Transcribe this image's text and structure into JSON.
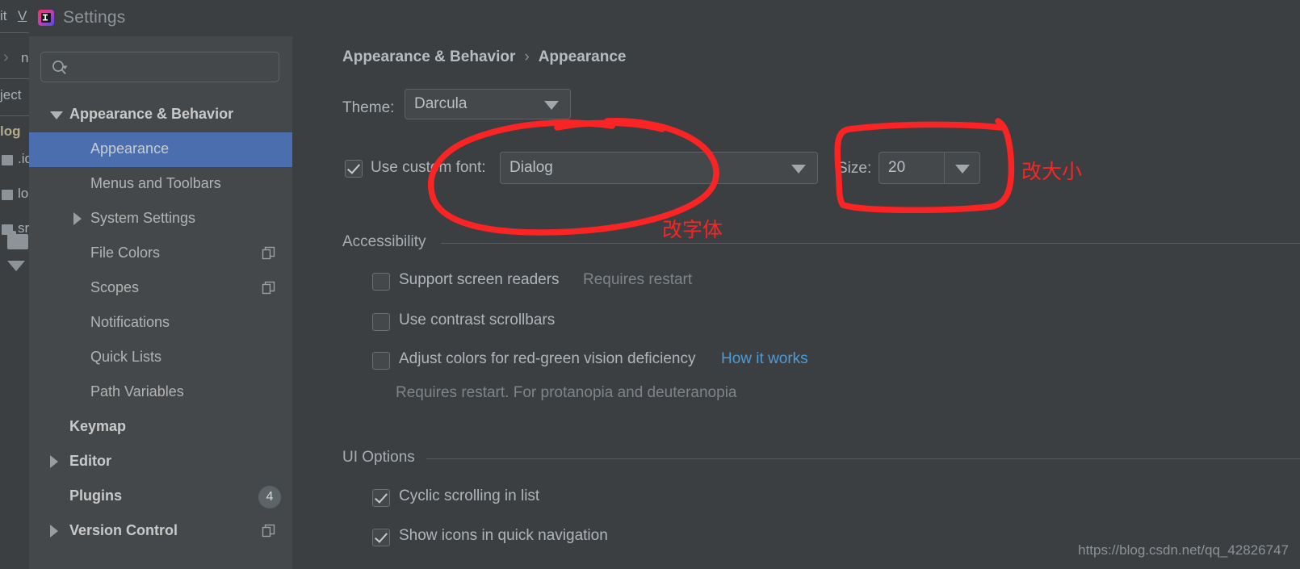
{
  "window": {
    "title": "Settings",
    "app_icon": "intellij-idea-icon"
  },
  "background_ide": {
    "menu_items": [
      "it",
      "V"
    ],
    "rows": [
      {
        "text": "n",
        "kind": "breadcrumb"
      },
      {
        "text": "ject",
        "kind": "text"
      },
      {
        "text": "log",
        "kind": "bold"
      },
      {
        "text": ".id",
        "kind": "file"
      },
      {
        "text": "log",
        "kind": "file"
      },
      {
        "text": "sr",
        "kind": "file"
      }
    ]
  },
  "sidebar": {
    "search": {
      "placeholder": "",
      "value": "",
      "icon": "search-icon"
    },
    "items": [
      {
        "label": "Appearance & Behavior",
        "level": "top",
        "expander": "down",
        "selected": false,
        "badge": null,
        "copy": false
      },
      {
        "label": "Appearance",
        "level": "child",
        "expander": "none",
        "selected": true,
        "badge": null,
        "copy": false
      },
      {
        "label": "Menus and Toolbars",
        "level": "child",
        "expander": "none",
        "selected": false,
        "badge": null,
        "copy": false
      },
      {
        "label": "System Settings",
        "level": "child",
        "expander": "right",
        "selected": false,
        "badge": null,
        "copy": false
      },
      {
        "label": "File Colors",
        "level": "child",
        "expander": "none",
        "selected": false,
        "badge": null,
        "copy": true
      },
      {
        "label": "Scopes",
        "level": "child",
        "expander": "none",
        "selected": false,
        "badge": null,
        "copy": true
      },
      {
        "label": "Notifications",
        "level": "child",
        "expander": "none",
        "selected": false,
        "badge": null,
        "copy": false
      },
      {
        "label": "Quick Lists",
        "level": "child",
        "expander": "none",
        "selected": false,
        "badge": null,
        "copy": false
      },
      {
        "label": "Path Variables",
        "level": "child",
        "expander": "none",
        "selected": false,
        "badge": null,
        "copy": false
      },
      {
        "label": "Keymap",
        "level": "top",
        "expander": "none",
        "selected": false,
        "badge": null,
        "copy": false
      },
      {
        "label": "Editor",
        "level": "top",
        "expander": "right",
        "selected": false,
        "badge": null,
        "copy": false
      },
      {
        "label": "Plugins",
        "level": "top",
        "expander": "none",
        "selected": false,
        "badge": "4",
        "copy": false
      },
      {
        "label": "Version Control",
        "level": "top",
        "expander": "right",
        "selected": false,
        "badge": null,
        "copy": true
      }
    ]
  },
  "main": {
    "breadcrumb": {
      "parent": "Appearance & Behavior",
      "separator": "›",
      "current": "Appearance"
    },
    "theme": {
      "label": "Theme:",
      "value": "Darcula"
    },
    "custom_font": {
      "checkbox_label": "Use custom font:",
      "checked": true,
      "font_value": "Dialog",
      "size_label": "Size:",
      "size_value": "20"
    },
    "accessibility": {
      "title": "Accessibility",
      "options": [
        {
          "label": "Support screen readers",
          "checked": false,
          "hint": "Requires restart",
          "link": null
        },
        {
          "label": "Use contrast scrollbars",
          "checked": false,
          "hint": null,
          "link": null
        },
        {
          "label": "Adjust colors for red-green vision deficiency",
          "checked": false,
          "hint": null,
          "link": "How it works"
        }
      ],
      "footnote": "Requires restart. For protanopia and deuteranopia"
    },
    "ui_options": {
      "title": "UI Options",
      "options": [
        {
          "label": "Cyclic scrolling in list",
          "checked": true
        },
        {
          "label": "Show icons in quick navigation",
          "checked": true
        }
      ]
    }
  },
  "annotations": {
    "font_note": "改字体",
    "size_note": "改大小",
    "color": "#fb2424"
  },
  "watermark": "https://blog.csdn.net/qq_42826747"
}
